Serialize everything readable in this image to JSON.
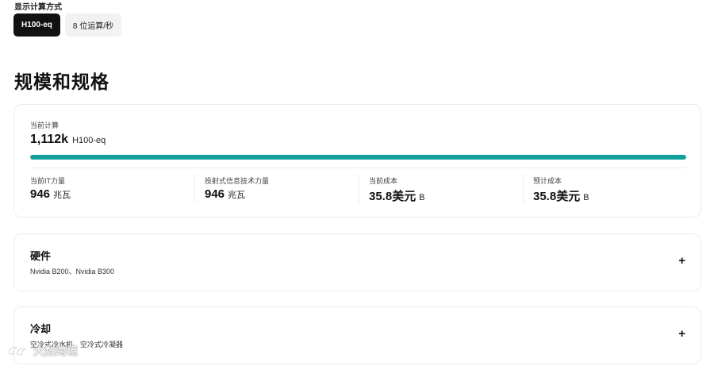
{
  "display_mode": {
    "label": "显示计算方式",
    "options": [
      {
        "label": "H100-eq",
        "selected": true
      },
      {
        "label": "8 位运算/秒",
        "selected": false
      }
    ]
  },
  "page_title": "规模和规格",
  "compute": {
    "label": "当前计算",
    "value": "1,112k",
    "unit": "H100-eq",
    "progress_fraction": 1.0,
    "accent_color": "#12a19a"
  },
  "metrics": [
    {
      "label": "当前IT力量",
      "value": "946",
      "unit": "兆瓦"
    },
    {
      "label": "投射式信息技术力量",
      "value": "946",
      "unit": "兆瓦"
    },
    {
      "label": "当前成本",
      "value": "35.8美元",
      "unit": "B"
    },
    {
      "label": "预计成本",
      "value": "35.8美元",
      "unit": "B"
    }
  ],
  "sections": {
    "hardware": {
      "title": "硬件",
      "subtitle": "Nvidia B200、Nvidia B300",
      "expand_icon": "plus-icon"
    },
    "cooling": {
      "title": "冷却",
      "subtitle": "空冷式冷水机、空冷式冷凝器",
      "expand_icon": "plus-icon"
    }
  },
  "watermark": {
    "text": "大数跨境"
  }
}
